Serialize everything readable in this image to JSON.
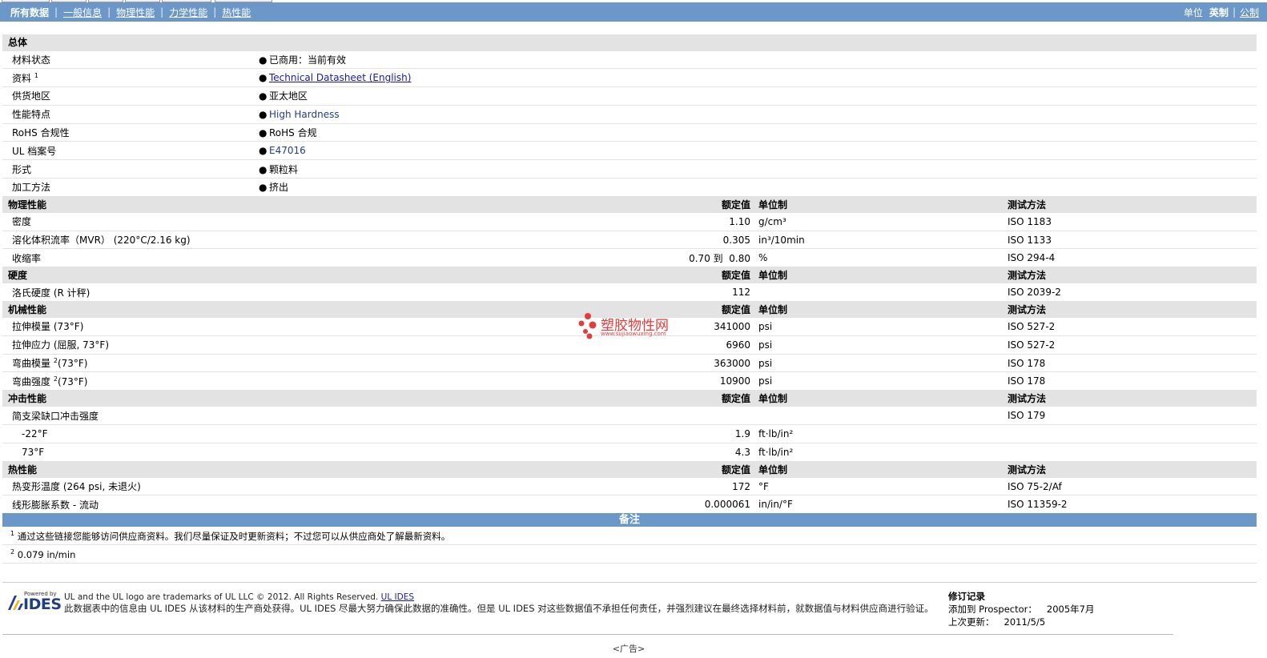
{
  "nav": {
    "items": [
      "所有数据",
      "一般信息",
      "物理性能",
      "力学性能",
      "热性能"
    ],
    "unit_label": "单位",
    "unit_options": [
      "英制",
      "公制"
    ]
  },
  "general": {
    "title": "总体",
    "rows": [
      {
        "label": "材料状态",
        "sup": "",
        "value": "已商用：当前有效"
      },
      {
        "label": "资料",
        "sup": "1",
        "value": "Technical Datasheet (English)"
      },
      {
        "label": "供货地区",
        "sup": "",
        "value": "亚太地区"
      },
      {
        "label": "性能特点",
        "sup": "",
        "value": "High Hardness"
      },
      {
        "label": "RoHS 合规性",
        "sup": "",
        "value": "RoHS 合规"
      },
      {
        "label": "UL 档案号",
        "sup": "",
        "value": "E47016"
      },
      {
        "label": "形式",
        "sup": "",
        "value": "颗粒料"
      },
      {
        "label": "加工方法",
        "sup": "",
        "value": "挤出"
      }
    ]
  },
  "col_heads": {
    "value": "额定值",
    "unit": "单位制",
    "test": "测试方法"
  },
  "physical": {
    "title": "物理性能",
    "rows": [
      {
        "label": "密度",
        "cond": "",
        "value": "1.10",
        "unit": "g/cm³",
        "test": "ISO 1183"
      },
      {
        "label": "溶化体积流率（MVR）",
        "cond": "(220°C/2.16 kg)",
        "value": "0.305",
        "unit": "in³/10min",
        "test": "ISO 1133"
      },
      {
        "label": "收缩率",
        "cond": "",
        "value": "0.70 到  0.80",
        "unit": "%",
        "test": "ISO 294-4"
      }
    ]
  },
  "hardness": {
    "title": "硬度",
    "rows": [
      {
        "label": "洛氏硬度",
        "cond": "(R 计秤)",
        "value": "112",
        "unit": "",
        "test": "ISO 2039-2"
      }
    ]
  },
  "mechanical": {
    "title": "机械性能",
    "rows": [
      {
        "label": "拉伸模量",
        "sup": "",
        "cond": "(73°F)",
        "value": "341000",
        "unit": "psi",
        "test": "ISO 527-2"
      },
      {
        "label": "拉伸应力",
        "sup": "",
        "cond": "(屈服, 73°F)",
        "value": "6960",
        "unit": "psi",
        "test": "ISO 527-2"
      },
      {
        "label": "弯曲模量",
        "sup": "2",
        "cond": "(73°F)",
        "value": "363000",
        "unit": "psi",
        "test": "ISO 178"
      },
      {
        "label": "弯曲强度",
        "sup": "2",
        "cond": "(73°F)",
        "value": "10900",
        "unit": "psi",
        "test": "ISO 178"
      }
    ]
  },
  "impact": {
    "title": "冲击性能",
    "parent": {
      "label": "简支梁缺口冲击强度",
      "test": "ISO 179"
    },
    "rows": [
      {
        "label": "-22°F",
        "value": "1.9",
        "unit": "ft·lb/in²"
      },
      {
        "label": "73°F",
        "value": "4.3",
        "unit": "ft·lb/in²"
      }
    ]
  },
  "thermal": {
    "title": "热性能",
    "rows": [
      {
        "label": "热变形温度",
        "cond": "(264 psi, 未退火)",
        "value": "172",
        "unit": "°F",
        "test": "ISO 75-2/Af"
      },
      {
        "label": "线形膨胀系数 - 流动",
        "cond": "",
        "value": "0.000061",
        "unit": "in/in/°F",
        "test": "ISO 11359-2"
      }
    ]
  },
  "notes": {
    "title": "备注",
    "items": [
      {
        "sup": "1",
        "text": "通过这些链接您能够访问供应商资料。我们尽量保证及时更新资料；不过您可以从供应商处了解最新资料。"
      },
      {
        "sup": "2",
        "text": "0.079 in/min"
      }
    ]
  },
  "footer": {
    "logo_powered": "Powered by",
    "logo_name": "IDES",
    "trademark": "UL and the UL logo are trademarks of UL LLC © 2012. All Rights Reserved.",
    "trademark_link": "UL IDES",
    "disclaimer": "此数据表中的信息由  UL IDES 从该材料的生产商处获得。UL IDES 尽最大努力确保此数据的准确性。但是  UL IDES 对这些数据值不承担任何责任，并强烈建议在最终选择材料前，就数据值与材料供应商进行验证。",
    "revision_title": "修订记录",
    "added_label": "添加到 Prospector：",
    "added_value": "2005年7月",
    "updated_label": "上次更新：",
    "updated_value": "2011/5/5",
    "ad": "<广告>"
  },
  "watermark": {
    "name": "塑胶物性网",
    "url": "www.sujiaowuxing.com"
  },
  "colors": {
    "nav_bg": "#6b98c9",
    "section_bg": "#e3e3e3",
    "link": "#1a1aa6",
    "watermark": "#e43b3b"
  }
}
